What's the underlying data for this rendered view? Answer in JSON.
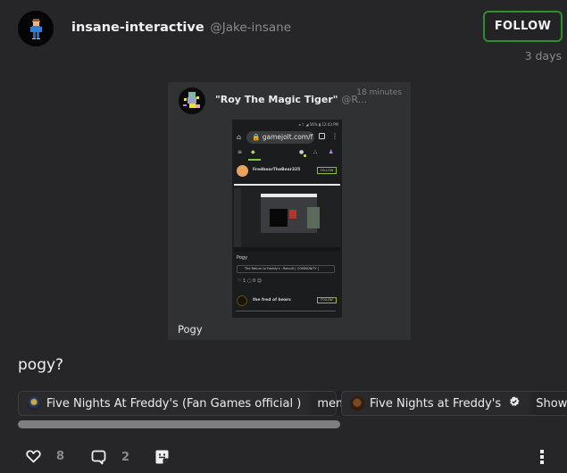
{
  "author": {
    "display_name": "insane-interactive",
    "handle": "@Jake-insane",
    "avatar_icon": "pixel-character-avatar"
  },
  "follow_button": {
    "label": "FOLLOW",
    "accent": "#2f8f2a"
  },
  "timestamp": "3 days",
  "media": {
    "quoted_author": "\"Roy The Magic Tiger\"",
    "quoted_handle": "@R...",
    "quoted_time": "18 minutes",
    "caption": "Pogy",
    "phone_screenshot": {
      "status_bar": "◂ ⊤ ◢ 56% ▮ 12:43 PM",
      "url": "gamejolt.com/f",
      "user1_name": "FredbearTheBear325",
      "user1_follow": "FOLLOW",
      "post_text": "Pogy",
      "community_tag": "The Return to Freddy's : Rebuilt [ COMMUNITY ]",
      "actions": "♡ 1   ▢ 0   ☺",
      "user2_name": "the fred of bears",
      "user2_follow": "FOLLOW"
    }
  },
  "post_text": "pogy?",
  "communities": [
    {
      "name": "Five Nights At Freddy's (Fan Games official )",
      "channel": "memes",
      "verified": false
    },
    {
      "name": "Five Nights at Freddy's",
      "channel": "Show &",
      "verified": true
    }
  ],
  "actions": {
    "likes": "8",
    "comments": "2",
    "like_icon": "heart-icon",
    "comment_icon": "comment-icon",
    "sticker_icon": "sticker-icon",
    "more_icon": "more-vertical-icon"
  }
}
